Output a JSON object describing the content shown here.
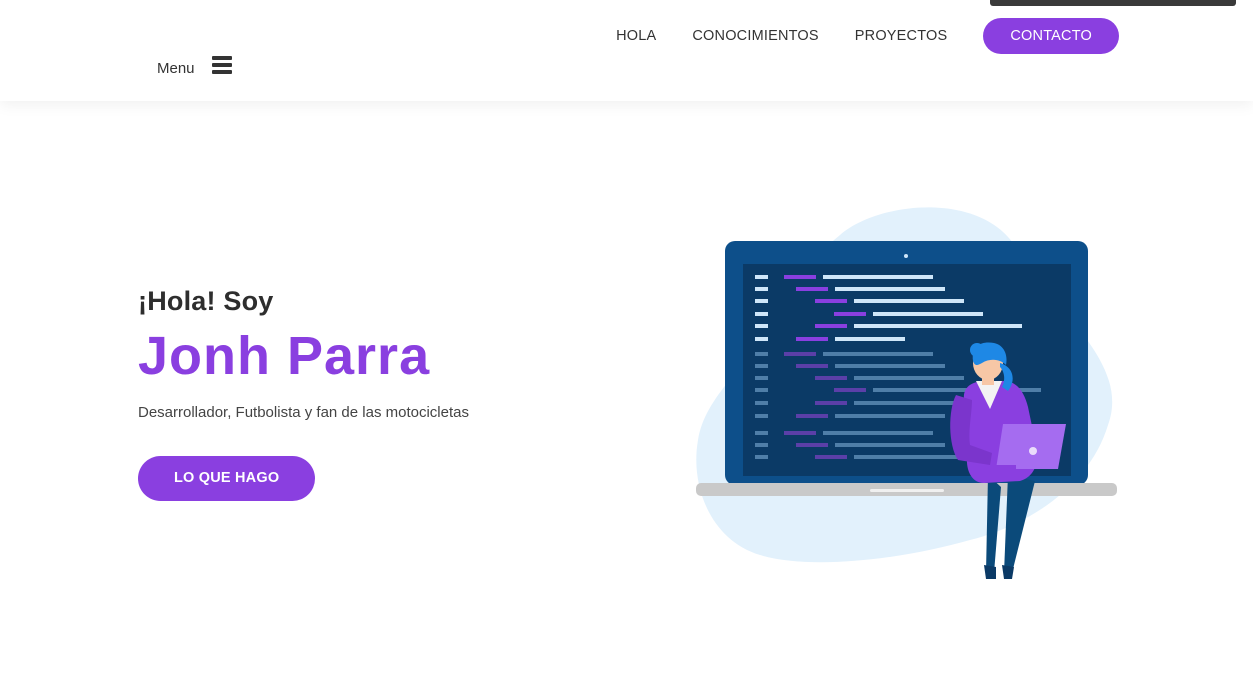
{
  "header": {
    "menu_label": "Menu",
    "nav": {
      "items": [
        {
          "label": "HOLA"
        },
        {
          "label": "CONOCIMIENTOS"
        },
        {
          "label": "PROYECTOS"
        }
      ],
      "cta_label": "CONTACTO"
    }
  },
  "hero": {
    "greeting": "¡Hola! Soy",
    "name": "Jonh Parra",
    "tagline": "Desarrollador, Futbolista y fan de las motocicletas",
    "button_label": "LO QUE HAGO"
  },
  "colors": {
    "accent": "#8a3fe0",
    "text": "#333333",
    "blob": "#e2f1fc",
    "laptop_frame": "#0d4f8a",
    "laptop_screen": "#0b3a66"
  }
}
